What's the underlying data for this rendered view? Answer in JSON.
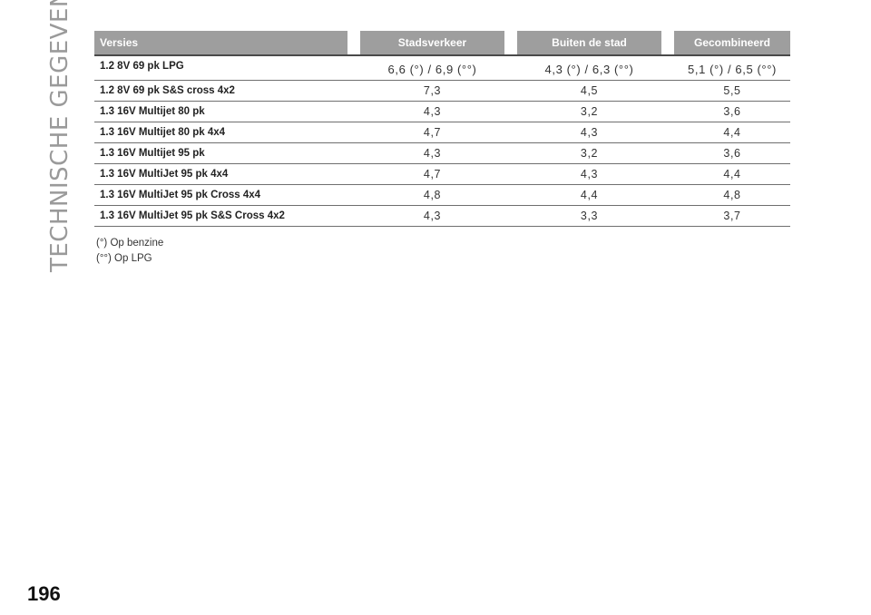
{
  "side_title": "TECHNISCHE GEGEVENS",
  "page_number": "196",
  "table": {
    "headers": [
      "Versies",
      "Stadsverkeer",
      "Buiten de stad",
      "Gecombineerd"
    ],
    "rows": [
      {
        "version": "1.2 8V 69 pk LPG",
        "city": "6,6 (°) / 6,9 (°°)",
        "outside": "4,3 (°) / 6,3 (°°)",
        "combined": "5,1 (°) / 6,5 (°°)"
      },
      {
        "version": "1.2 8V 69 pk S&S cross 4x2",
        "city": "7,3",
        "outside": "4,5",
        "combined": "5,5"
      },
      {
        "version": "1.3 16V Multijet 80 pk",
        "city": "4,3",
        "outside": "3,2",
        "combined": "3,6"
      },
      {
        "version": "1.3 16V Multijet 80 pk 4x4",
        "city": "4,7",
        "outside": "4,3",
        "combined": "4,4"
      },
      {
        "version": "1.3 16V Multijet 95 pk",
        "city": "4,3",
        "outside": "3,2",
        "combined": "3,6"
      },
      {
        "version": "1.3 16V MultiJet 95 pk 4x4",
        "city": "4,7",
        "outside": "4,3",
        "combined": "4,4"
      },
      {
        "version": "1.3 16V MultiJet 95 pk Cross 4x4",
        "city": "4,8",
        "outside": "4,4",
        "combined": "4,8"
      },
      {
        "version": "1.3 16V MultiJet 95 pk S&S Cross 4x2",
        "city": "4,3",
        "outside": "3,3",
        "combined": "3,7"
      }
    ]
  },
  "footnotes": [
    "(°) Op benzine",
    "(°°) Op LPG"
  ]
}
